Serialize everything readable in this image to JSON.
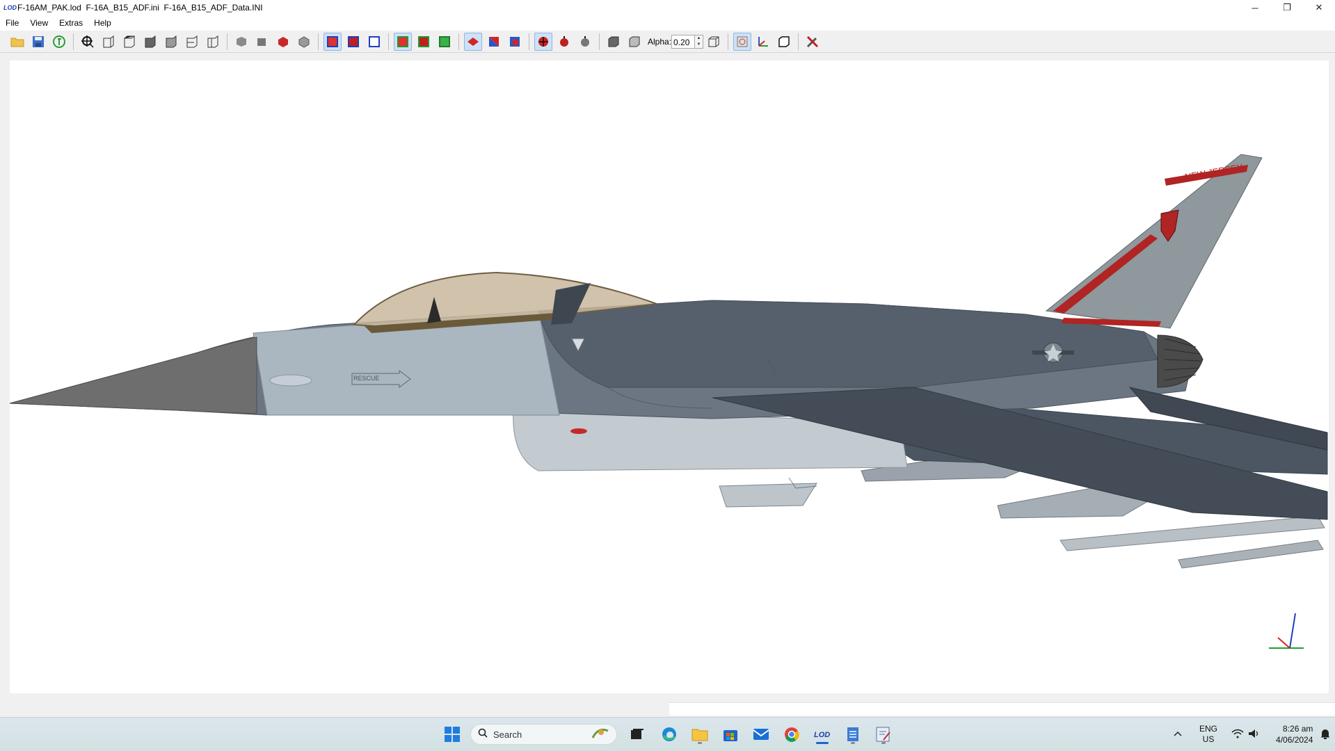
{
  "window": {
    "app_badge": "LOD",
    "title": "F-16AM_PAK.lod  F-16A_B15_ADF.ini  F-16A_B15_ADF_Data.INI",
    "minimize_glyph": "─",
    "maximize_glyph": "❐",
    "close_glyph": "✕"
  },
  "menu": [
    "File",
    "View",
    "Extras",
    "Help"
  ],
  "toolbar": {
    "alpha_label": "Alpha:",
    "alpha_value": "0.20",
    "spin_up": "▲",
    "spin_down": "▼"
  },
  "model": {
    "tail_text": "NEW JERSEY",
    "rescue_text": "RESCUE",
    "colors": {
      "fuselage": "#5c6673",
      "canopy": "#b8a48a",
      "tail": "#8a9296",
      "accent": "#b02424"
    }
  },
  "taskbar": {
    "search_placeholder": "Search",
    "lang_top": "ENG",
    "lang_bottom": "US",
    "time": "8:26 am",
    "date": "4/06/2024",
    "pinned": [
      "start-icon",
      "task-view-icon",
      "edge-icon",
      "file-explorer-icon",
      "store-icon",
      "mail-icon",
      "chrome-icon",
      "lod-viewer-icon",
      "notepad-icon",
      "editor-icon"
    ]
  }
}
